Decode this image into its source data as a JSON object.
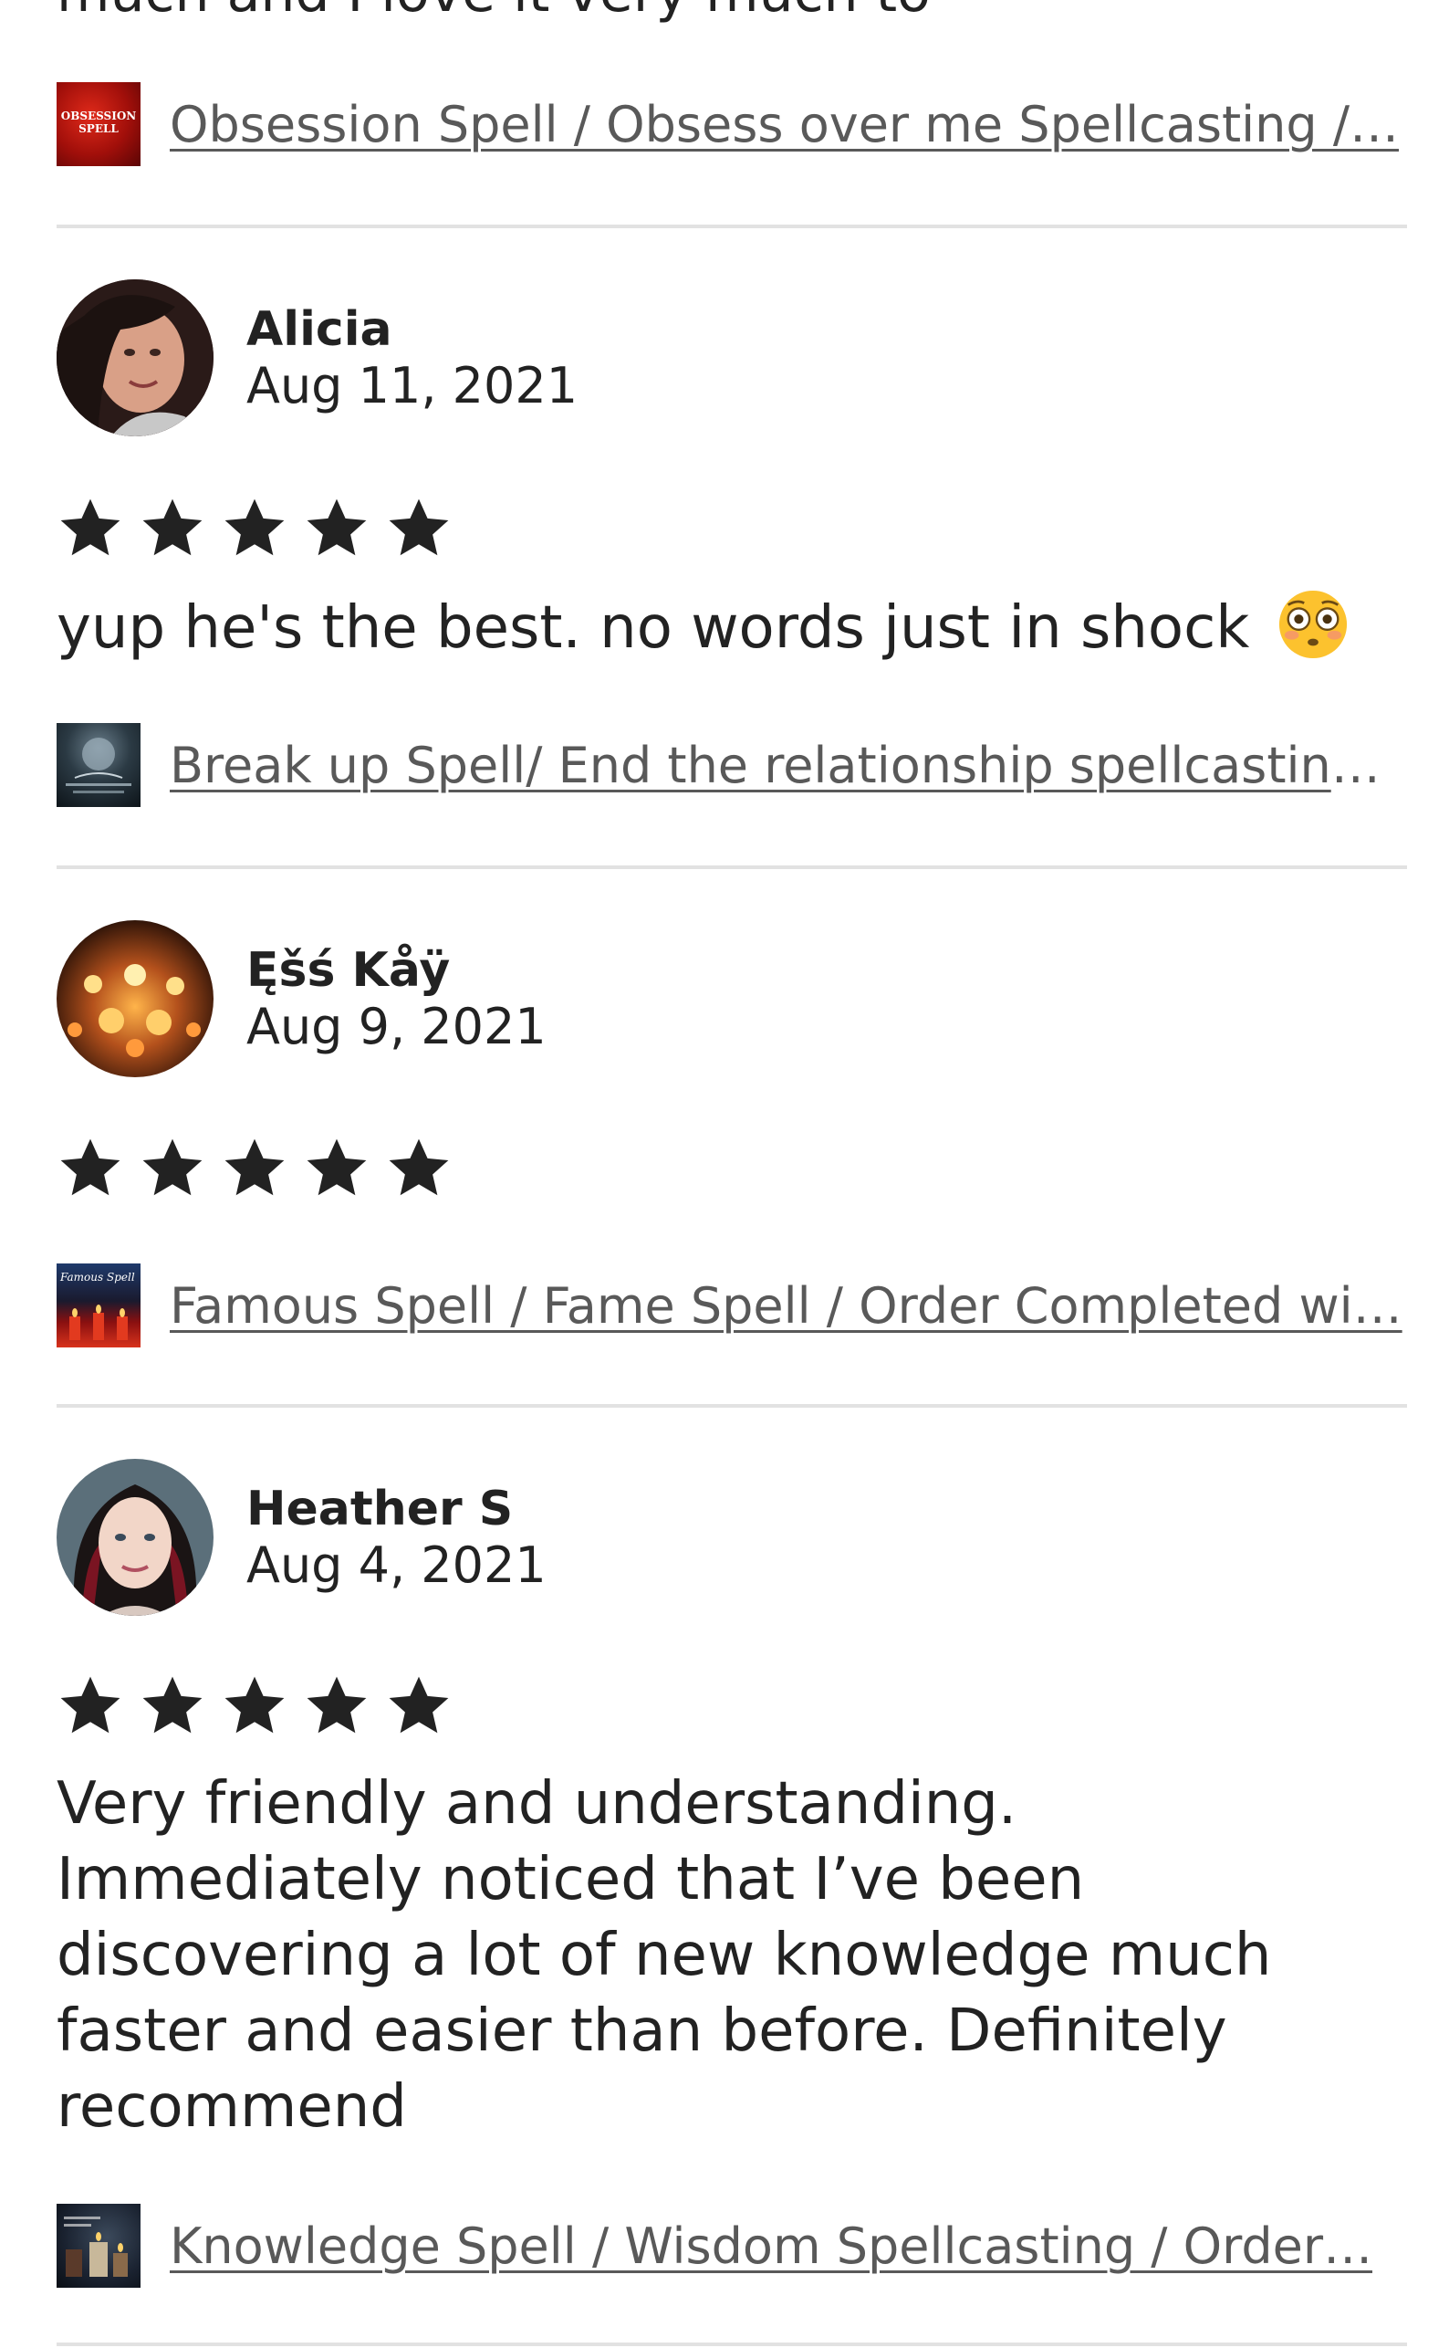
{
  "cut_off_text": "much and I love it very much to",
  "reviews": [
    {
      "product": {
        "title": "Obsession Spell / Obsess over me Spellcasting /…",
        "thumb_text": "OBSESSION SPELL"
      }
    },
    {
      "name": "Alicia",
      "date": "Aug 11, 2021",
      "rating": 5,
      "text": "yup he's the best.  no words just in shock",
      "emoji": "flushed-face",
      "product": {
        "title": "Break up Spell/ End the relationship spellcasting…"
      }
    },
    {
      "name": "Ęšś Kåÿ",
      "date": "Aug 9, 2021",
      "rating": 5,
      "text": "",
      "product": {
        "title": "Famous Spell / Fame Spell / Order Completed wi…",
        "thumb_text": "Famous Spell"
      }
    },
    {
      "name": "Heather S",
      "date": "Aug 4, 2021",
      "rating": 5,
      "text": "Very friendly and understanding. Immediately noticed that I’ve been discovering a lot of new knowledge much faster and easier than before. Definitely recommend",
      "product": {
        "title": "Knowledge Spell / Wisdom Spellcasting / Order…"
      }
    }
  ],
  "colors": {
    "text": "#222222",
    "link": "#595959",
    "divider": "#e2e2e2",
    "star": "#222222"
  }
}
